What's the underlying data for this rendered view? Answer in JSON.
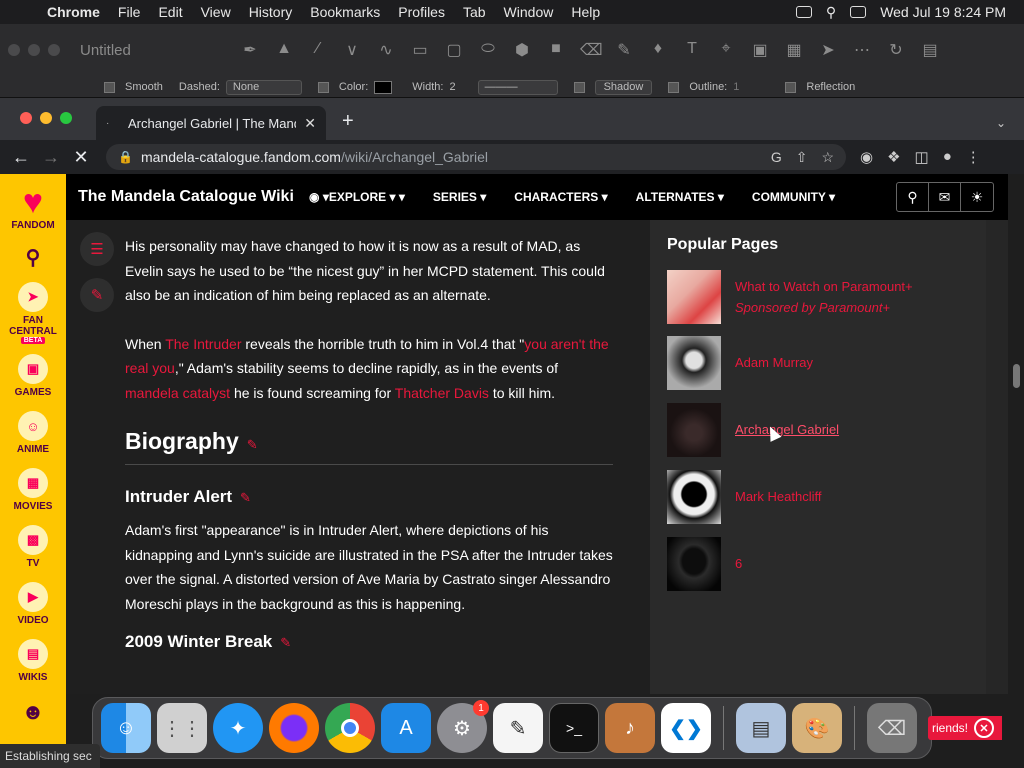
{
  "menubar": {
    "app": "Chrome",
    "items": [
      "File",
      "Edit",
      "View",
      "History",
      "Bookmarks",
      "Profiles",
      "Tab",
      "Window",
      "Help"
    ],
    "datetime": "Wed Jul 19  8:24 PM"
  },
  "draw_app": {
    "title": "Untitled",
    "smooth": "Smooth",
    "dashed": "Dashed:",
    "dashed_value": "None",
    "color": "Color:",
    "width": "Width:",
    "width_value": "2",
    "shadow": "Shadow",
    "outline": "Outline:",
    "outline_value": "1",
    "reflection": "Reflection"
  },
  "browser": {
    "tab_title": "Archangel Gabriel | The Mande",
    "url_host": "mandela-catalogue.fandom.com",
    "url_path": "/wiki/Archangel_Gabriel"
  },
  "rail": {
    "brand": "FANDOM",
    "fan_central": "FAN CENTRAL",
    "beta": "BETA",
    "items": [
      "GAMES",
      "ANIME",
      "MOVIES",
      "TV",
      "VIDEO",
      "WIKIS"
    ]
  },
  "wiki": {
    "name": "The Mandela Catalogue Wiki",
    "nav": [
      "EXPLORE",
      "SERIES",
      "CHARACTERS",
      "ALTERNATES",
      "COMMUNITY"
    ]
  },
  "article": {
    "p1": "His personality may have changed to how it is now as a result of MAD, as Evelin says he used to be “the nicest guy” in her MCPD statement. This could also be an indication of him being replaced as an alternate.",
    "p2": {
      "t1": "When ",
      "l1": "The Intruder",
      "t2": " reveals the horrible truth to him in Vol.4 that \"",
      "l2": "you aren't the real you",
      "t3": ",\" Adam's stability seems to decline rapidly, as in the events of ",
      "l3": "mandela catalyst",
      "t4": " he is found screaming for ",
      "l4": "Thatcher Davis",
      "t5": " to kill him."
    },
    "h_bio": "Biography",
    "h_intruder": "Intruder Alert",
    "p3": "Adam's first \"appearance\" is in Intruder Alert, where depictions of his kidnapping and Lynn's suicide are illustrated in the PSA after the Intruder takes over the signal. A distorted version of Ave Maria by Castrato singer Alessandro Moreschi plays in the background as this is happening.",
    "h_winter": "2009 Winter Break"
  },
  "popular": {
    "title": "Popular Pages",
    "items": [
      {
        "label": "What to Watch on Paramount+",
        "sub": "Sponsored by Paramount+"
      },
      {
        "label": "Adam Murray"
      },
      {
        "label": "Archangel Gabriel"
      },
      {
        "label": "Mark Heathcliff"
      },
      {
        "label": "6"
      }
    ]
  },
  "status": "Establishing sec",
  "friends": "riends!",
  "dock_badge": "1",
  "colors": {
    "fandom_yellow": "#fec600",
    "link_red": "#e8183c",
    "fandom_pink": "#fa005a"
  }
}
